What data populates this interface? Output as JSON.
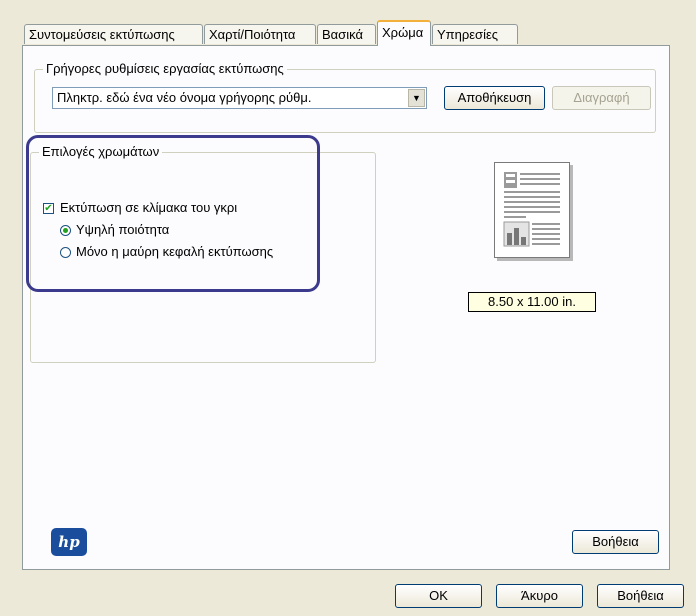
{
  "tabs": [
    "Συντομεύσεις εκτύπωσης",
    "Χαρτί/Ποιότητα",
    "Βασικά",
    "Χρώμα",
    "Υπηρεσίες"
  ],
  "active_tab": "Χρώμα",
  "quick_settings": {
    "group_title": "Γρήγορες ρυθμίσεις εργασίας εκτύπωσης",
    "combo_value": "Πληκτρ. εδώ ένα νέο όνομα γρήγορης ρύθμ.",
    "save_label": "Αποθήκευση",
    "delete_label": "Διαγραφή"
  },
  "color_options": {
    "group_title": "Επιλογές χρωμάτων",
    "grayscale_label": "Εκτύπωση σε κλίμακα του γκρι",
    "grayscale_checked": true,
    "high_quality_label": "Υψηλή ποιότητα",
    "black_only_label": "Μόνο η μαύρη κεφαλή εκτύπωσης",
    "selected": "high_quality"
  },
  "preview": {
    "size_label": "8.50 x 11.00 in."
  },
  "logo_text": "hp",
  "panel_help_label": "Βοήθεια",
  "footer": {
    "ok_label": "OK",
    "cancel_label": "Άκυρο",
    "help_label": "Βοήθεια"
  },
  "colors": {
    "highlight": "#3b3a8c",
    "tab_accent": "#f3b03a",
    "check": "#21a121",
    "tooltip_bg": "#ffffe1"
  },
  "icons": {
    "document_preview": "document-preview-icon",
    "logo": "hp-logo"
  }
}
